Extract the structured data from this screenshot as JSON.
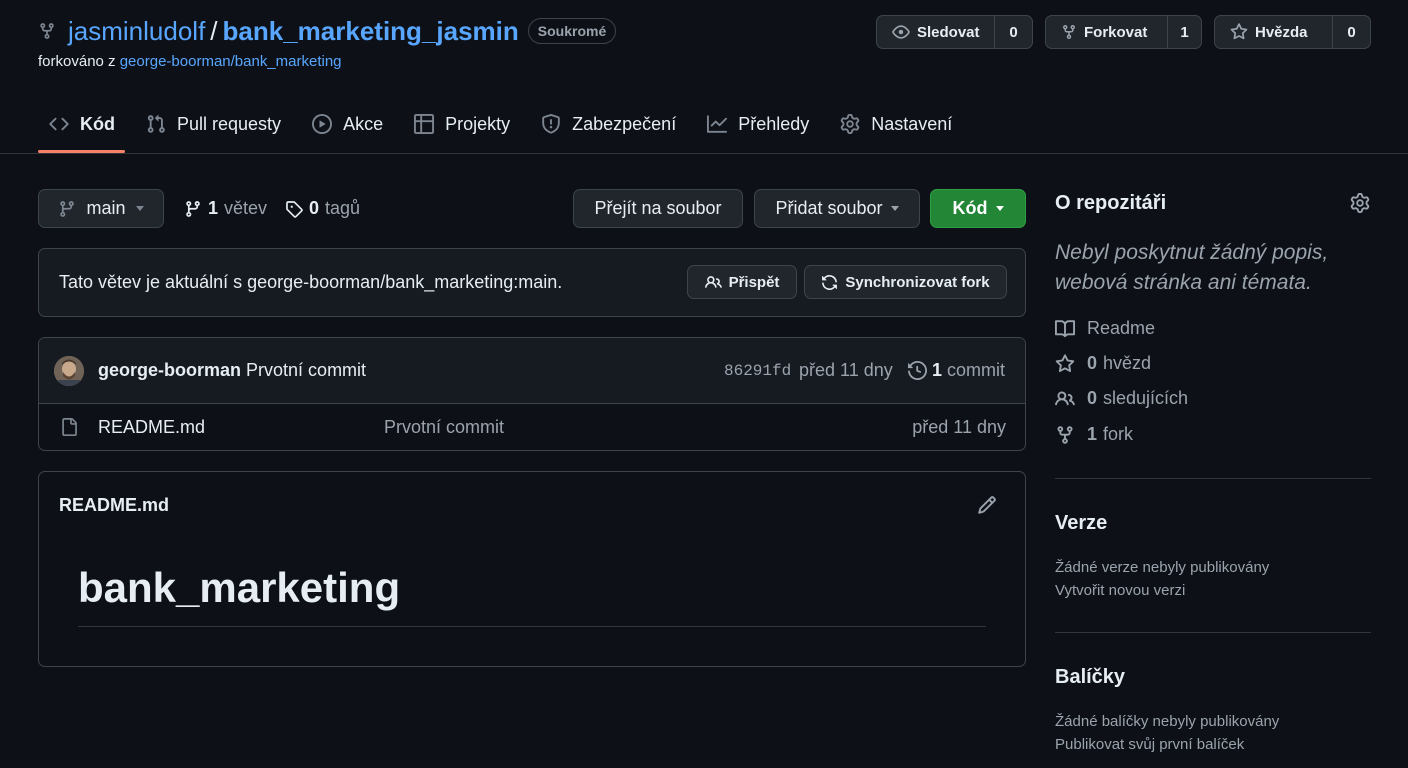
{
  "repo": {
    "owner": "jasminludolf",
    "separator": "/",
    "name": "bank_marketing_jasmin",
    "visibility": "Soukromé",
    "forked_prefix": "forkováno z",
    "forked_from": "george-boorman/bank_marketing"
  },
  "actions": {
    "watch_label": "Sledovat",
    "watch_count": "0",
    "fork_label": "Forkovat",
    "fork_count": "1",
    "star_label": "Hvězda",
    "star_count": "0"
  },
  "tabs": [
    {
      "label": "Kód",
      "icon": "code-icon"
    },
    {
      "label": "Pull requesty",
      "icon": "pull-request-icon"
    },
    {
      "label": "Akce",
      "icon": "play-icon"
    },
    {
      "label": "Projekty",
      "icon": "table-icon"
    },
    {
      "label": "Zabezpečení",
      "icon": "shield-icon"
    },
    {
      "label": "Přehledy",
      "icon": "graph-icon"
    },
    {
      "label": "Nastavení",
      "icon": "gear-icon"
    }
  ],
  "toolbar": {
    "branch": "main",
    "branches_count": "1",
    "branches_label": "větev",
    "tags_count": "0",
    "tags_label": "tagů",
    "goto_file": "Přejít na soubor",
    "add_file": "Přidat soubor",
    "code": "Kód"
  },
  "sync": {
    "message": "Tato větev je aktuální s george-boorman/bank_marketing:main.",
    "contribute": "Přispět",
    "sync_fork": "Synchronizovat fork"
  },
  "latest_commit": {
    "author": "george-boorman",
    "message": "Prvotní commit",
    "sha": "86291fd",
    "time": "před 11 dny",
    "count": "1",
    "count_label": "commit"
  },
  "files": [
    {
      "name": "README.md",
      "message": "Prvotní commit",
      "time": "před 11 dny"
    }
  ],
  "readme": {
    "filename": "README.md",
    "heading": "bank_marketing"
  },
  "sidebar": {
    "about_title": "O repozitáři",
    "description": "Nebyl poskytnut žádný popis, webová stránka ani témata.",
    "readme": "Readme",
    "stars_count": "0",
    "stars_label": "hvězd",
    "watchers_count": "0",
    "watchers_label": "sledujících",
    "forks_count": "1",
    "forks_label": "fork",
    "releases_title": "Verze",
    "releases_empty": "Žádné verze nebyly publikovány",
    "releases_link": "Vytvořit novou verzi",
    "packages_title": "Balíčky",
    "packages_empty": "Žádné balíčky nebyly publikovány",
    "packages_link": "Publikovat svůj první balíček"
  },
  "colors": {
    "background": "#0d1117",
    "link": "#58a6ff",
    "accent_underline": "#f78166",
    "primary_button": "#238636"
  }
}
